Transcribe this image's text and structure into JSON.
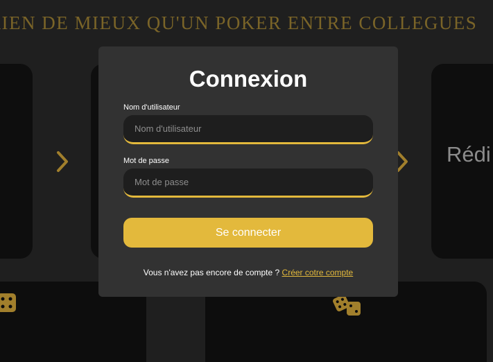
{
  "background": {
    "banner": "RIEN DE MIEUX QU'UN POKER ENTRE COLLEGUES",
    "card_partial_text": "Rédi",
    "accent_color": "#e3b93c",
    "banner_color": "#7a6428"
  },
  "login": {
    "title": "Connexion",
    "username_label": "Nom d'utilisateur",
    "username_placeholder": "Nom d'utilisateur",
    "username_value": "",
    "password_label": "Mot de passe",
    "password_placeholder": "Mot de passe",
    "password_value": "",
    "submit_label": "Se connecter",
    "signup_prompt": "Vous n'avez pas encore de compte ?",
    "signup_link": "Créer cotre compte"
  },
  "icons": [
    "chevron-right-icon",
    "chevron-right-icon",
    "dice-icon",
    "dice-icon"
  ]
}
